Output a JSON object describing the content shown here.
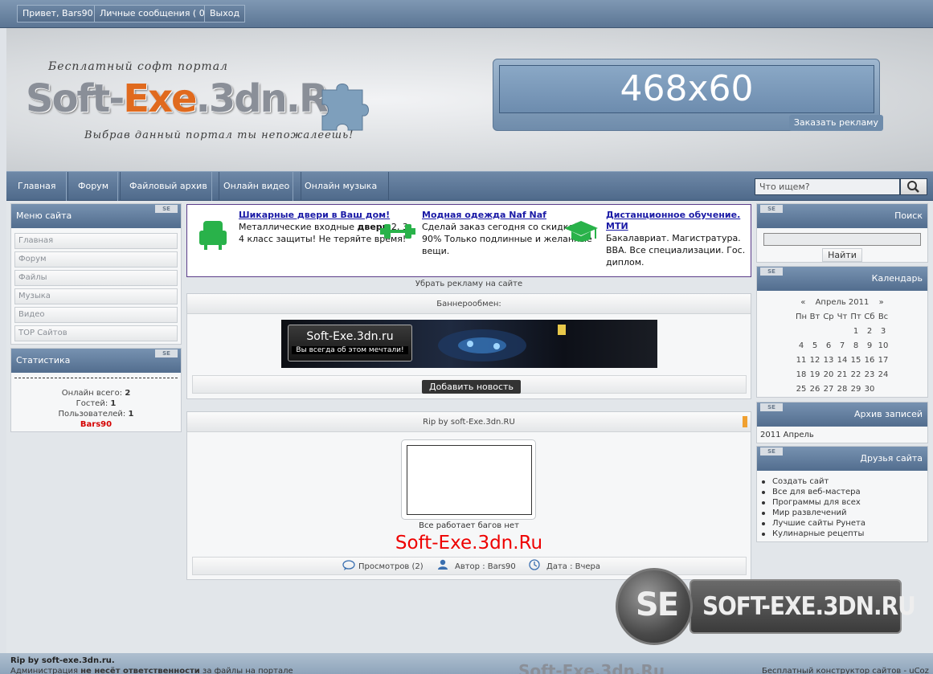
{
  "topbar": {
    "greeting": "Привет, Bars90",
    "messages": "Личные сообщения ( 0 )",
    "logout": "Выход"
  },
  "header": {
    "slogan_top": "Бесплатный софт портал",
    "logo_part1": "Soft-",
    "logo_part2": "Exe",
    "logo_part3": ".3dn.Ru",
    "slogan_bottom": "Выбрав данный портал ты непожалеешь!",
    "ad_size": "468x60",
    "ad_order": "Заказать рекламу"
  },
  "nav": {
    "items": [
      "Главная",
      "Форум",
      "Файловый архив",
      "Онлайн видео",
      "Онлайн музыка"
    ],
    "search_placeholder": "Что ищем?"
  },
  "left": {
    "menu_title": "Меню сайта",
    "menu_items": [
      "Главная",
      "Форум",
      "Файлы",
      "Музыка",
      "Видео",
      "TOP Сайтов"
    ],
    "stats_title": "Статистика",
    "online_total_label": "Онлайн всего:",
    "online_total": "2",
    "guests_label": "Гостей:",
    "guests": "1",
    "users_label": "Пользователей:",
    "users": "1",
    "user_name": "Bars90"
  },
  "ads": [
    {
      "title": "Шикарные двери в Ваш дом!",
      "text_a": "Металлические входные ",
      "text_b": "двери",
      "text_c": " 2, 3, 4 класс защиты! Не теряйте время!"
    },
    {
      "title": "Модная одежда Naf Naf",
      "text_a": "Сделай заказ сегодня со скидкой 90% Только подлинные и желанные вещи.",
      "text_b": "",
      "text_c": ""
    },
    {
      "title": "Дистанционное обучение. МТИ",
      "text_a": "Бакалавриат. Магистратура. BBA. Все специализации. Гос. диплом.",
      "text_b": "",
      "text_c": ""
    }
  ],
  "center": {
    "remove_ads": "Убрать рекламу на сайте",
    "banner_exchange_title": "Баннерообмен:",
    "banner_line1": "Soft-Exe.3dn.ru",
    "banner_line2": "Вы всегда об этом мечтали!",
    "add_news": "Добавить новость",
    "post_title": "Rip by soft-Exe.3dn.RU",
    "post_caption": "Все работает багов нет",
    "post_brand": "Soft-Exe.3dn.Ru",
    "views": "Просмотров (2)",
    "author": "Автор : Bars90",
    "date": "Дата : Вчера"
  },
  "right": {
    "search_title": "Поиск",
    "search_button": "Найти",
    "calendar_title": "Календарь",
    "calendar_month": "Апрель 2011",
    "calendar_prev": "«",
    "calendar_next": "»",
    "weekdays": [
      "Пн",
      "Вт",
      "Ср",
      "Чт",
      "Пт",
      "Сб",
      "Вс"
    ],
    "weeks": [
      [
        "",
        "",
        "",
        "",
        "1",
        "2",
        "3"
      ],
      [
        "4",
        "5",
        "6",
        "7",
        "8",
        "9",
        "10"
      ],
      [
        "11",
        "12",
        "13",
        "14",
        "15",
        "16",
        "17"
      ],
      [
        "18",
        "19",
        "20",
        "21",
        "22",
        "23",
        "24"
      ],
      [
        "25",
        "26",
        "27",
        "28",
        "29",
        "30",
        ""
      ]
    ],
    "archive_title": "Архив записей",
    "archive_item": "2011 Апрель",
    "friends_title": "Друзья сайта",
    "friends": [
      "Создать сайт",
      "Все для веб-мастера",
      "Программы для всех",
      "Мир развлечений",
      "Лучшие сайты Рунета",
      "Кулинарные рецепты"
    ]
  },
  "watermark": {
    "badge": "SE",
    "text": "SOFT-EXE.3DN.RU"
  },
  "footer": {
    "line1": "Rip by soft-exe.3dn.ru.",
    "line2a": "Администрация ",
    "line2b": "не несёт ответственности",
    "line2c": " за файлы на портале",
    "right": "Бесплатный конструктор сайтов - uCoz",
    "logo": "Soft-Exe.3dn.Ru"
  },
  "se_label": "SE"
}
